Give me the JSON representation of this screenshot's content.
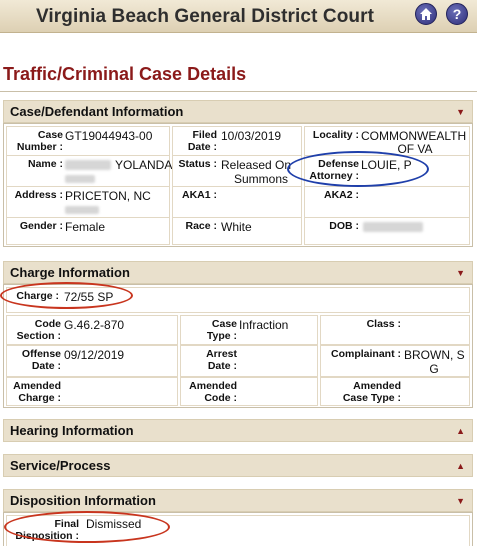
{
  "header": {
    "title": "Virginia Beach General District Court"
  },
  "page_title": "Traffic/Criminal Case Details",
  "sections": {
    "case": "Case/Defendant Information",
    "charge": "Charge Information",
    "hearing": "Hearing Information",
    "service": "Service/Process",
    "disposition": "Disposition Information"
  },
  "case_info": {
    "case_number_label": "Case Number :",
    "case_number": "GT19044943-00",
    "filed_label": "Filed Date :",
    "filed": "10/03/2019",
    "locality_label": "Locality :",
    "locality_1": "COMMONWEALTH",
    "locality_2": "OF VA",
    "name_label": "Name :",
    "name_value": "YOLANDA",
    "status_label": "Status :",
    "status_1": "Released On",
    "status_2": "Summons",
    "defense_label_1": "Defense",
    "defense_label_2": "Attorney :",
    "defense_value": "LOUIE, P",
    "address_label": "Address :",
    "address_value": "PRICETON, NC",
    "aka1_label": "AKA1 :",
    "aka2_label": "AKA2 :",
    "gender_label": "Gender :",
    "gender_value": "Female",
    "race_label": "Race :",
    "race_value": "White",
    "dob_label": "DOB :"
  },
  "charge_info": {
    "charge_label": "Charge :",
    "charge_value": "72/55 SP",
    "code_label_1": "Code",
    "code_label_2": "Section :",
    "code_value": "G.46.2-870",
    "case_type_label_1": "Case",
    "case_type_label_2": "Type :",
    "case_type_value": "Infraction",
    "class_label": "Class :",
    "offense_label_1": "Offense",
    "offense_label_2": "Date :",
    "offense_value": "09/12/2019",
    "arrest_label_1": "Arrest",
    "arrest_label_2": "Date :",
    "complainant_label": "Complainant :",
    "complainant_1": "BROWN, S",
    "complainant_2": "G",
    "amended_charge_1": "Amended",
    "amended_charge_2": "Charge :",
    "amended_code_1": "Amended",
    "amended_code_2": "Code :",
    "amended_case_type_1": "Amended",
    "amended_case_type_2": "Case Type :"
  },
  "disposition_info": {
    "final_label": "Final",
    "disposition_label": "Disposition :",
    "final_value": "Dismissed"
  },
  "colors": {
    "accent": "#8b1a1a",
    "header_bg": "#e9e0cc",
    "annotation_blue": "#1f3faa",
    "annotation_red": "#c8351e"
  },
  "icons": {
    "home": "home-icon",
    "help": "help-icon",
    "collapse": "triangle-down-icon",
    "expand": "triangle-up-icon"
  }
}
